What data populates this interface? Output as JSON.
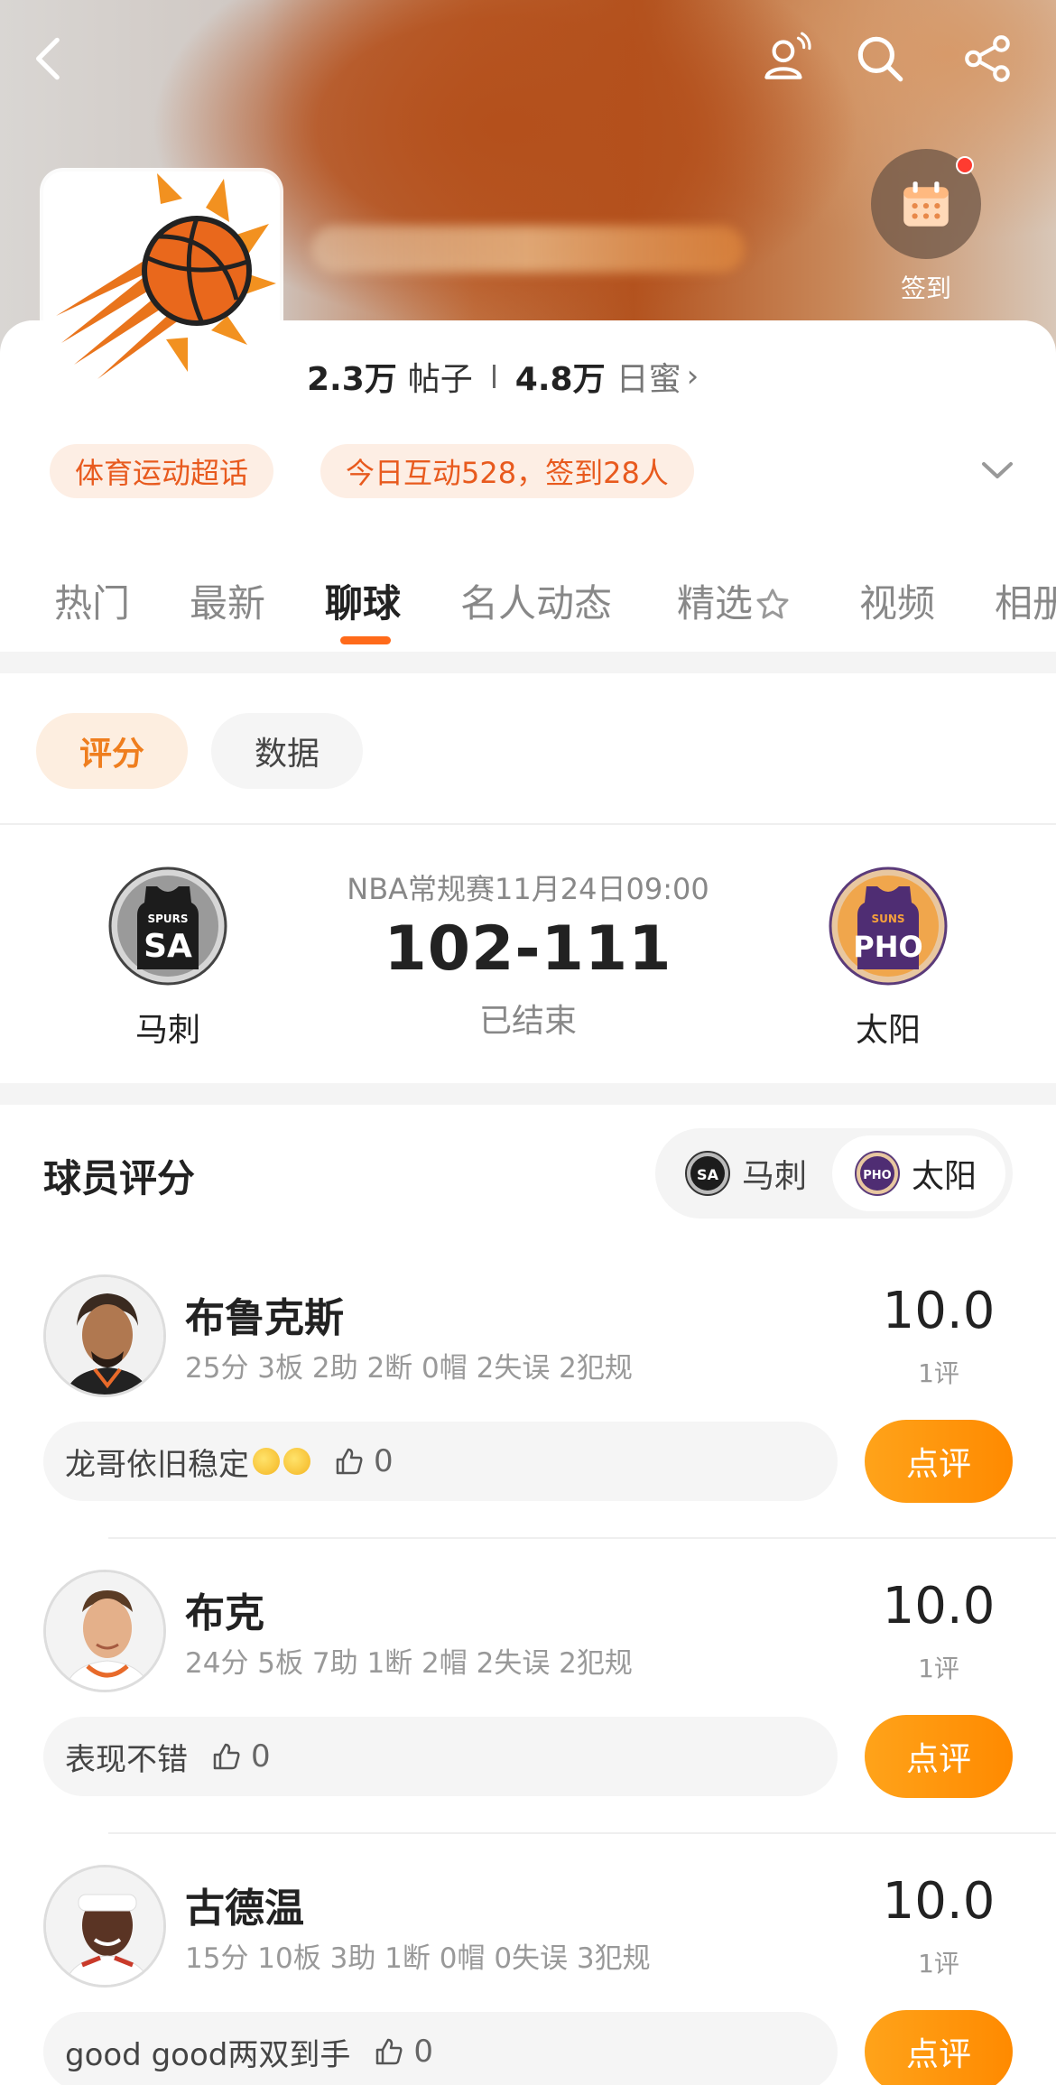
{
  "header": {
    "checkin_label": "签到"
  },
  "community": {
    "posts_count": "2.3万",
    "posts_label": "帖子",
    "members_count": "4.8万",
    "members_label": "日蜜",
    "chevron": "›",
    "tags": [
      "体育运动超话",
      "今日互动528，签到28人"
    ]
  },
  "tabs": [
    {
      "label": "热门"
    },
    {
      "label": "最新"
    },
    {
      "label": "聊球"
    },
    {
      "label": "名人动态"
    },
    {
      "label": "精选"
    },
    {
      "label": "视频"
    },
    {
      "label": "相册"
    }
  ],
  "active_tab": "聊球",
  "segments": {
    "score": "评分",
    "data": "数据"
  },
  "game": {
    "meta": "NBA常规赛11月24日09:00",
    "score": "102-111",
    "status": "已结束",
    "home": {
      "name": "马刺",
      "abbr": "SA",
      "small": "SPURS"
    },
    "away": {
      "name": "太阳",
      "abbr": "PHO",
      "small": "SUNS"
    }
  },
  "ratings": {
    "title": "球员评分",
    "toggle": {
      "spurs": "马刺",
      "suns": "太阳"
    },
    "rate_button": "点评",
    "players": [
      {
        "name": "布鲁克斯",
        "stats": "25分 3板 2助 2断 0帽 2失误 2犯规",
        "score": "10.0",
        "count": "1评",
        "comment": "龙哥依旧稳定",
        "likes": "0"
      },
      {
        "name": "布克",
        "stats": "24分 5板 7助 1断 2帽 2失误 2犯规",
        "score": "10.0",
        "count": "1评",
        "comment": "表现不错",
        "likes": "0"
      },
      {
        "name": "古德温",
        "stats": "15分 10板 3助 1断 0帽 0失误 3犯规",
        "score": "10.0",
        "count": "1评",
        "comment": "good good两双到手",
        "likes": "0"
      }
    ]
  },
  "colors": {
    "accent": "#ff6a1a",
    "button_orange": "#ff9a10",
    "tag_bg": "#fdeee4",
    "tag_text": "#e85a1e"
  }
}
